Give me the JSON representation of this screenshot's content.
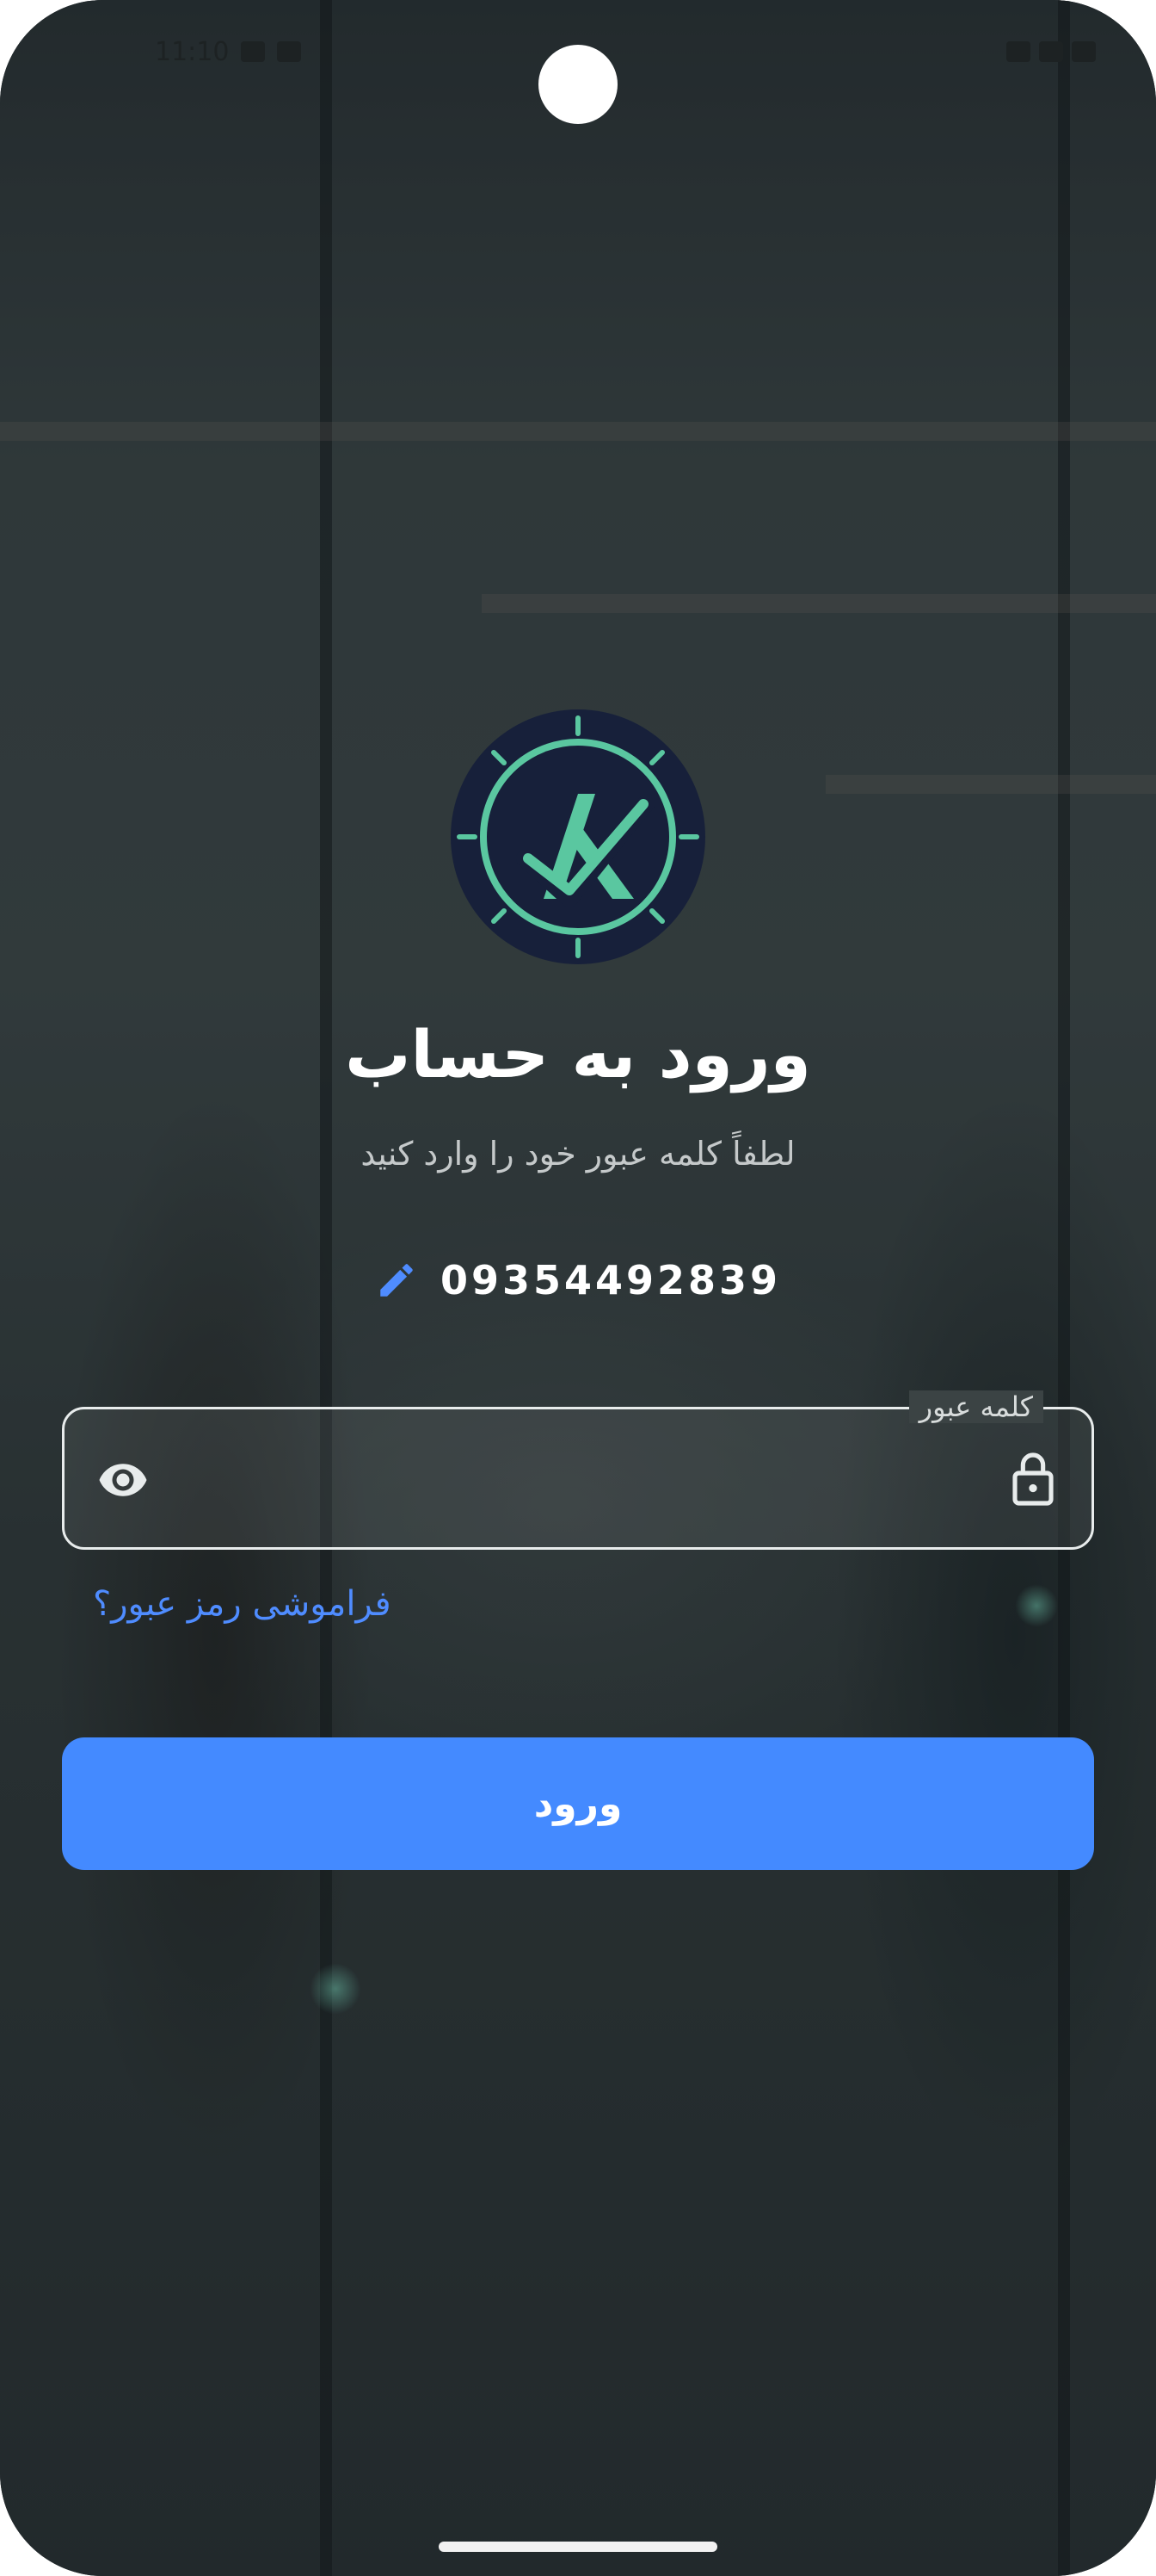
{
  "status_bar": {
    "time": "11:10"
  },
  "login": {
    "title": "ورود به حساب",
    "subtitle": "لطفاً کلمه عبور خود را وارد کنید",
    "phone_number": "09354492839",
    "password_label": "کلمه عبور",
    "password_value": "",
    "forgot_password": "فراموشی رمز عبور؟",
    "submit_label": "ورود"
  },
  "colors": {
    "accent": "#448aff",
    "link": "#4f8cff",
    "logo_green": "#5ac7a0",
    "logo_bg": "#17203a"
  },
  "icons": {
    "edit": "pencil-icon",
    "visibility": "eye-icon",
    "lock": "lock-icon",
    "logo": "checkmark-compass-logo"
  }
}
